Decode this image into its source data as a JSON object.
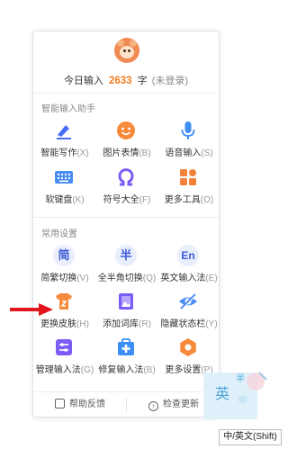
{
  "header": {
    "prefix": "今日输入",
    "count": "2633",
    "unit": "字",
    "login_status": "(未登录)"
  },
  "sections": {
    "assistant_title": "智能输入助手",
    "settings_title": "常用设置"
  },
  "assistant": [
    {
      "label": "智能写作",
      "key": "(X)",
      "icon": "pen-icon",
      "color": "#4a6cf7"
    },
    {
      "label": "图片表情",
      "key": "(B)",
      "icon": "emoji-icon",
      "color": "#f7893b"
    },
    {
      "label": "语音输入",
      "key": "(S)",
      "icon": "microphone-icon",
      "color": "#3d8ef7"
    },
    {
      "label": "软键盘",
      "key": "(K)",
      "icon": "keyboard-icon",
      "color": "#4a8df6"
    },
    {
      "label": "符号大全",
      "key": "(F)",
      "icon": "omega-icon",
      "color": "#7b5cf5"
    },
    {
      "label": "更多工具",
      "key": "(O)",
      "icon": "grid-icon",
      "color": "#f2823a"
    }
  ],
  "settings": [
    {
      "label": "简繁切换",
      "key": "(V)",
      "glyph": "简",
      "icon": "simplified-traditional-icon"
    },
    {
      "label": "全半角切换",
      "key": "(Q)",
      "glyph": "半",
      "icon": "half-width-icon"
    },
    {
      "label": "英文输入法",
      "key": "(E)",
      "glyph": "En",
      "icon": "english-icon"
    },
    {
      "label": "更换皮肤",
      "key": "(H)",
      "icon": "skin-icon",
      "color": "#f7893b"
    },
    {
      "label": "添加词库",
      "key": "(R)",
      "icon": "dictionary-icon",
      "color": "#7b5cf5"
    },
    {
      "label": "隐藏状态栏",
      "key": "(Y)",
      "icon": "eye-hidden-icon",
      "color": "#4a8df6"
    },
    {
      "label": "管理输入法",
      "key": "(G)",
      "icon": "manage-icon",
      "color": "#7b5cf5"
    },
    {
      "label": "修复输入法",
      "key": "(B)",
      "icon": "repair-icon",
      "color": "#3d8ef7"
    },
    {
      "label": "更多设置",
      "key": "(P)",
      "icon": "gear-icon",
      "color": "#f7893b"
    }
  ],
  "footer": {
    "feedback": "帮助反馈",
    "update": "检查更新"
  },
  "statusbar": {
    "mode_en": "英",
    "mode_half": "半"
  },
  "tooltip": "中/英文(Shift)"
}
